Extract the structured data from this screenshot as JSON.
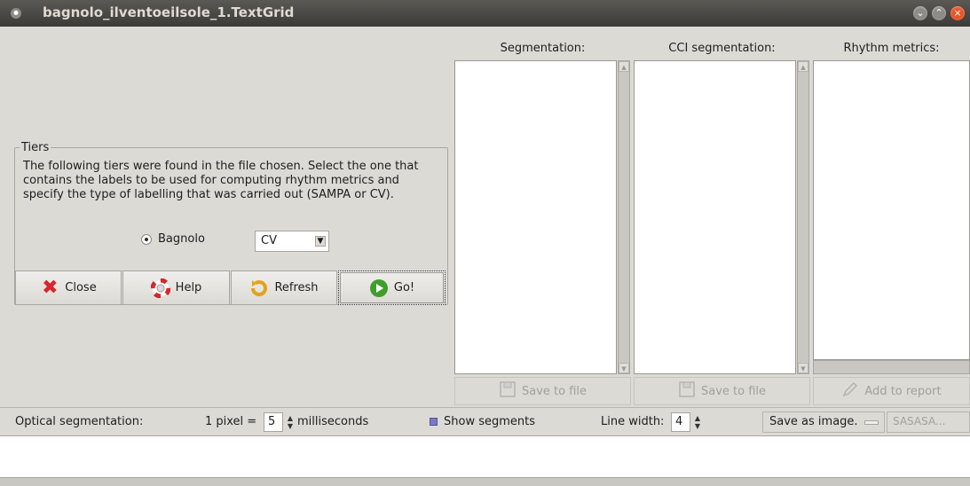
{
  "window": {
    "title": "bagnolo_ilventoeilsole_1.TextGrid"
  },
  "columns": {
    "segmentation": "Segmentation:",
    "cci": "CCI segmentation:",
    "rhythm": "Rhythm metrics:"
  },
  "tiers": {
    "legend": "Tiers",
    "description": "The following tiers were found in the file chosen. Select the one that contains the labels to be used for computing rhythm metrics and specify the type of labelling that was carried out (SAMPA or CV).",
    "tier_name": "Bagnolo",
    "label_type": "CV"
  },
  "buttons": {
    "close": "Close",
    "help": "Help",
    "refresh": "Refresh",
    "go": "Go!"
  },
  "panel_actions": {
    "save_segmentation": "Save to file",
    "save_cci": "Save to file",
    "add_report": "Add to report"
  },
  "optical": {
    "label": "Optical segmentation:",
    "pixel_prefix": "1 pixel =",
    "pixel_value": "5",
    "pixel_unit": "milliseconds",
    "show_segments": "Show segments",
    "line_width_label": "Line width:",
    "line_width_value": "4",
    "save_image": "Save as image.",
    "pattern_value": "SASASA..."
  },
  "icons": {
    "window_dot": "window-menu-icon",
    "close": "close-x-icon",
    "help": "lifebuoy-help-icon",
    "refresh": "refresh-icon",
    "go": "go-play-icon",
    "save": "floppy-disk-icon",
    "report": "pencil-report-icon"
  },
  "colors": {
    "titlebar": "#3c3b37",
    "window_bg": "#dcdad5",
    "close_icon": "#d8262c",
    "go_icon": "#3f9e2c",
    "checkbox": "#7b78c8"
  }
}
